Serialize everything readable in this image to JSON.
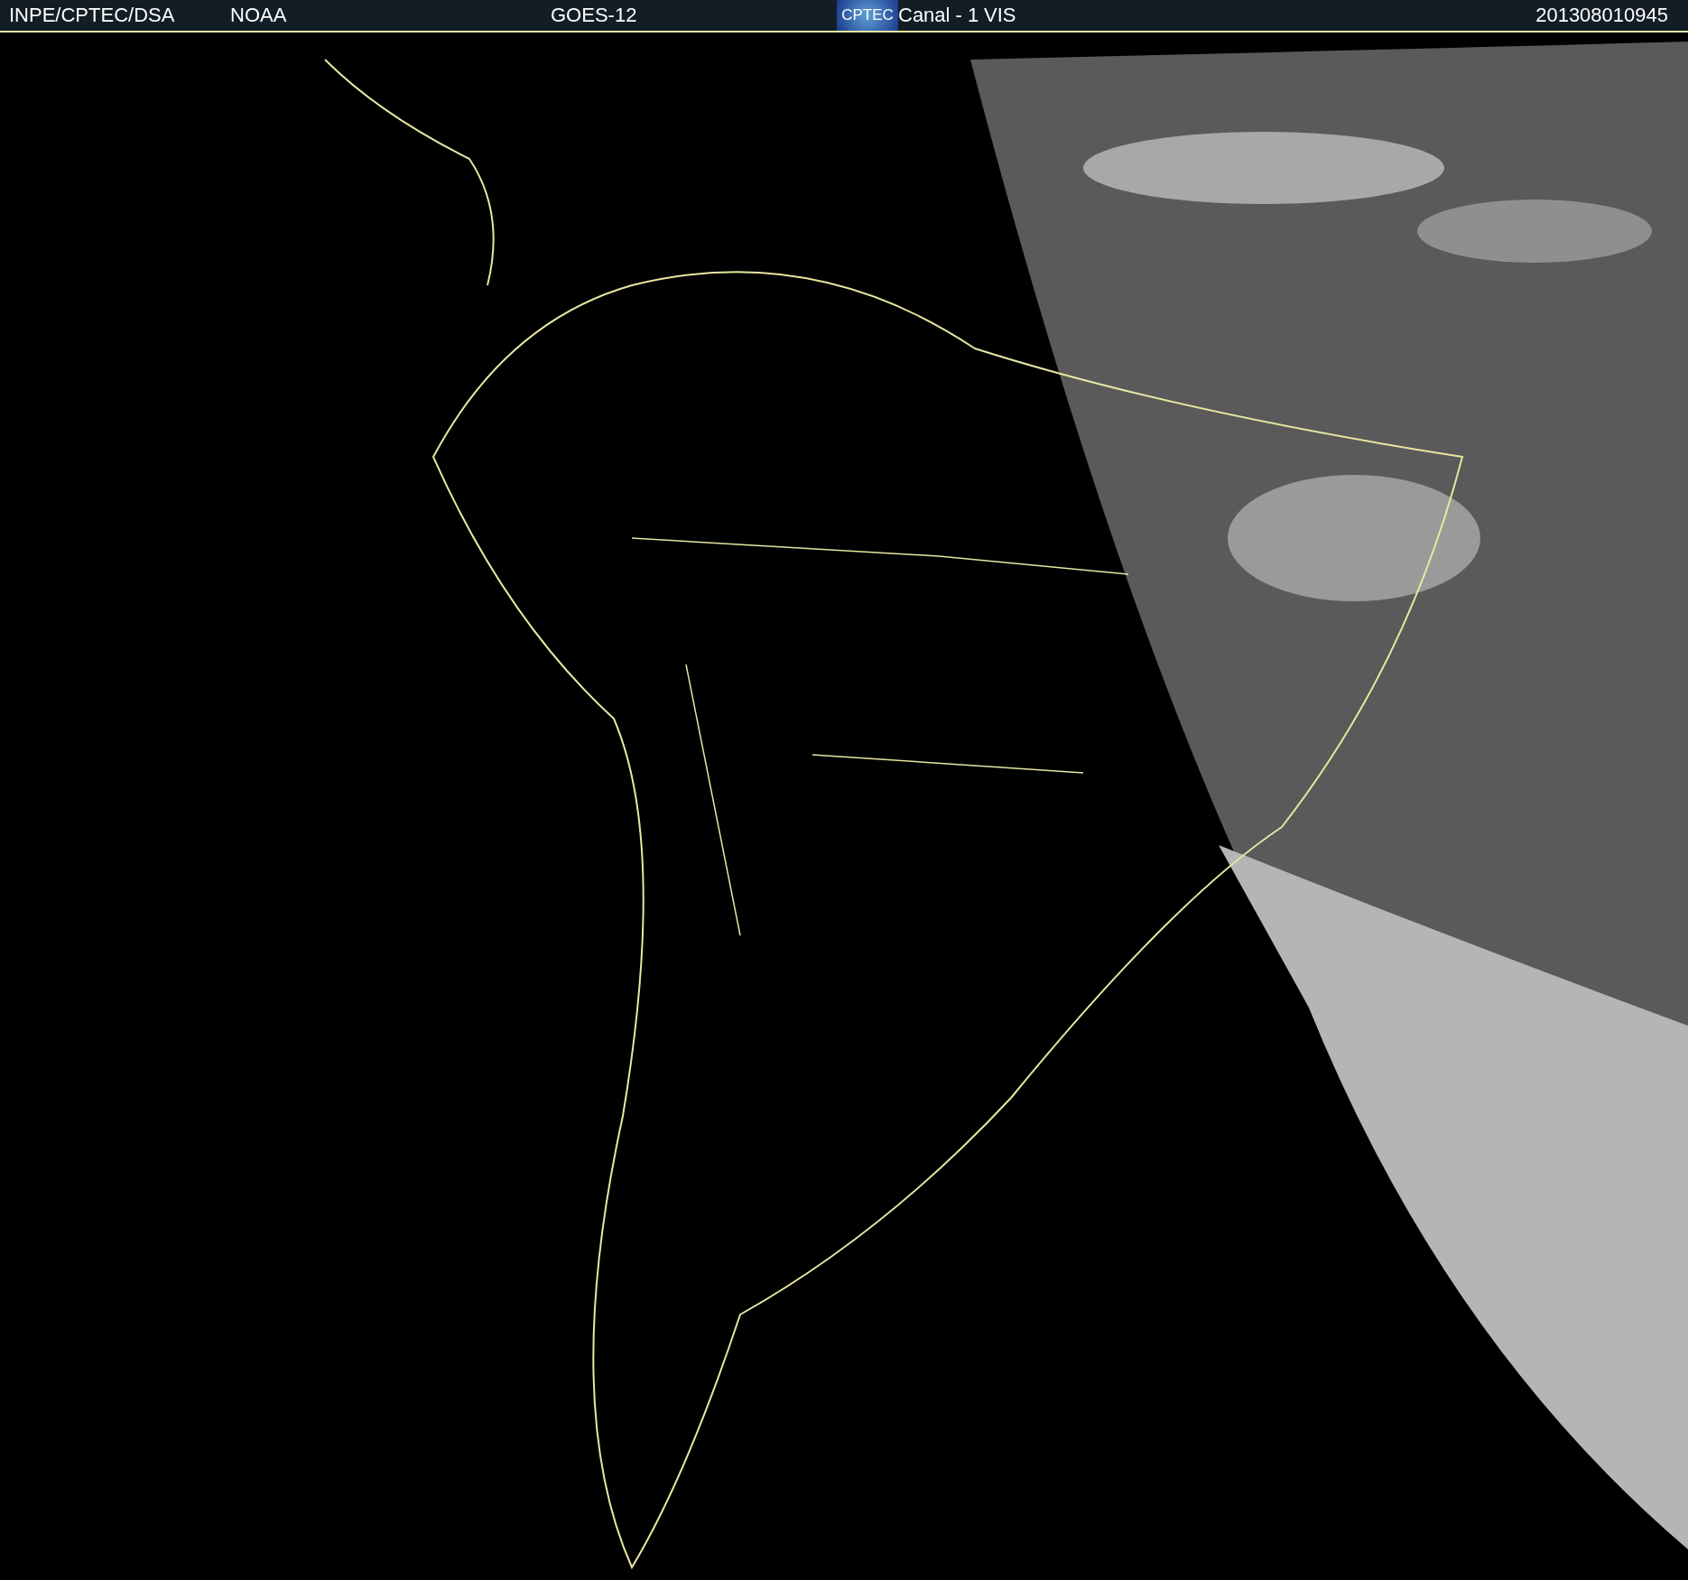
{
  "header": {
    "source": "INPE/CPTEC/DSA",
    "agency": "NOAA",
    "satellite": "GOES-12",
    "logo": "CPTEC",
    "channel": "Canal - 1",
    "band": "VIS",
    "timestamp": "201308010945"
  }
}
